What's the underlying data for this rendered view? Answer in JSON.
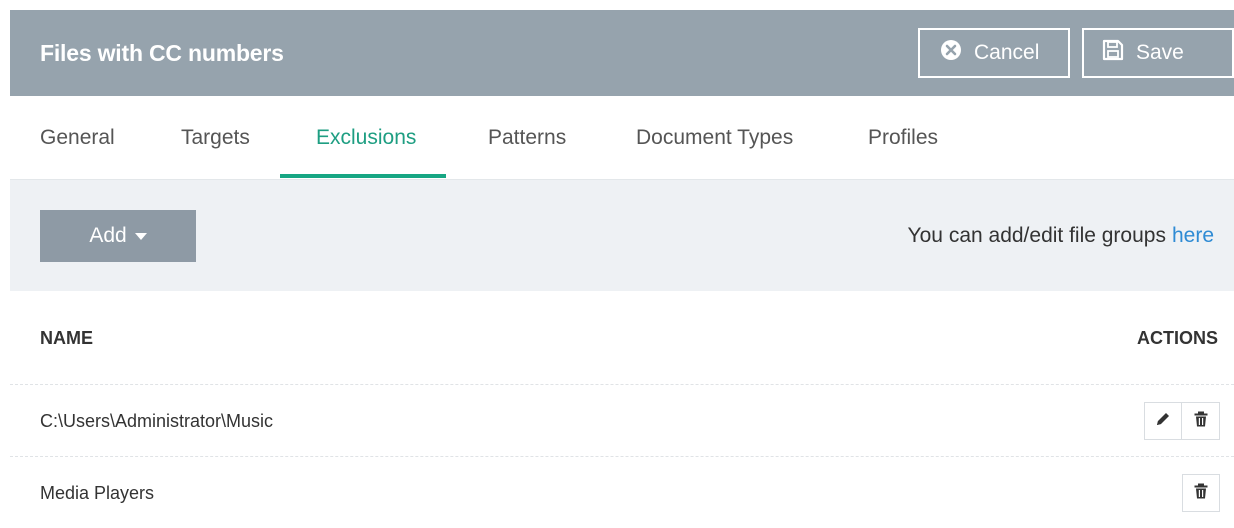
{
  "header": {
    "title": "Files with CC numbers",
    "cancel_label": "Cancel",
    "save_label": "Save"
  },
  "tabs": [
    {
      "label": "General",
      "active": false
    },
    {
      "label": "Targets",
      "active": false
    },
    {
      "label": "Exclusions",
      "active": true
    },
    {
      "label": "Patterns",
      "active": false
    },
    {
      "label": "Document Types",
      "active": false
    },
    {
      "label": "Profiles",
      "active": false
    }
  ],
  "toolbar": {
    "add_label": "Add",
    "hint_text": "You can add/edit file groups",
    "hint_link": "here"
  },
  "table": {
    "columns": {
      "name": "NAME",
      "actions": "ACTIONS"
    },
    "rows": [
      {
        "name": "C:\\Users\\Administrator\\Music",
        "actions": [
          "edit-icon",
          "trash-icon"
        ]
      },
      {
        "name": "Media Players",
        "actions": [
          "trash-icon"
        ]
      }
    ]
  },
  "colors": {
    "header_bg": "#96a3ad",
    "accent": "#17a683",
    "link": "#2e8bd4",
    "toolbar_bg": "#eef1f4",
    "add_button_bg": "#8e9aa5"
  }
}
